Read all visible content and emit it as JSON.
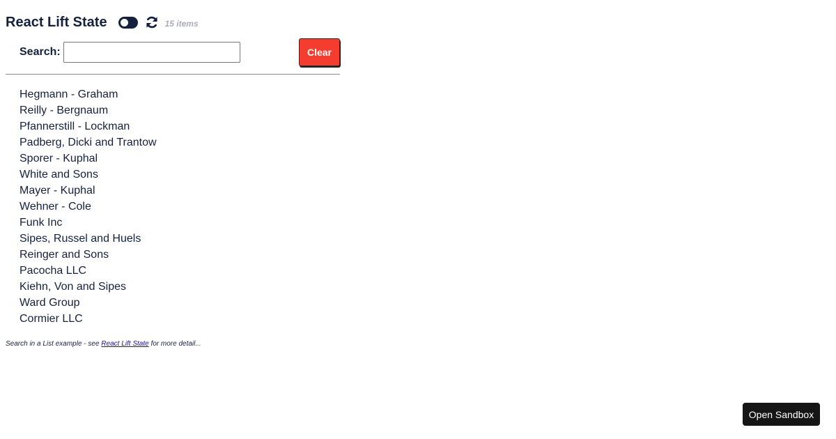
{
  "header": {
    "title": "React Lift State",
    "item_count": "15 items"
  },
  "search": {
    "label": "Search:",
    "value": "",
    "placeholder": "",
    "clear_label": "Clear"
  },
  "items": [
    "Hegmann - Graham",
    "Reilly - Bergnaum",
    "Pfannerstill - Lockman",
    "Padberg, Dicki and Trantow",
    "Sporer - Kuphal",
    "White and Sons",
    "Mayer - Kuphal",
    "Wehner - Cole",
    "Funk Inc",
    "Sipes, Russel and Huels",
    "Reinger and Sons",
    "Pacocha LLC",
    "Kiehn, Von and Sipes",
    "Ward Group",
    "Cormier LLC"
  ],
  "footer": {
    "prefix": "Search in a List example - see ",
    "link_text": "React Lift State",
    "suffix": " for more detail..."
  },
  "sandbox": {
    "label": "Open Sandbox"
  },
  "icons": {
    "toggle": "toggle-off-icon",
    "refresh": "refresh-icon"
  },
  "colors": {
    "text": "#13213f",
    "clear_button": "#f53d2f",
    "muted": "#a9adb5",
    "sandbox_button": "#151515"
  }
}
